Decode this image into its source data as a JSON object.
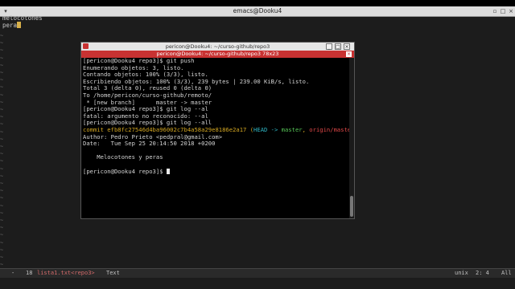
{
  "emacs": {
    "title": "emacs@Dooku4",
    "buffer_lines": [
      "melocotones",
      "pera"
    ],
    "modeline": {
      "status": "-",
      "line": "18",
      "buffer": "lista1.txt<repo3>",
      "mode": "Text",
      "encoding": "unix",
      "position": "2: 4",
      "scroll": "All"
    }
  },
  "terminal": {
    "window_title": "pericon@Dooku4: ~/curso-github/repo3",
    "tab_title": "pericon@Dooku4: ~/curso-github/repo3 78x23",
    "lines": [
      "[pericon@Dooku4 repo3]$ git push",
      "Enumerando objetos: 3, listo.",
      "Contando objetos: 100% (3/3), listo.",
      "Escribiendo objetos: 100% (3/3), 239 bytes | 239.00 KiB/s, listo.",
      "Total 3 (delta 0), reused 0 (delta 0)",
      "To /home/pericon/curso-github/remoto/",
      " * [new branch]      master -> master",
      "[pericon@Dooku4 repo3]$ git log --al",
      "fatal: argumento no reconocido: --al",
      "[pericon@Dooku4 repo3]$ git log --all"
    ],
    "commit": {
      "label": "commit",
      "hash": "efb8fc27546d4ba96002c7b4a58a29e8186e2a17",
      "open": " (",
      "head": "HEAD -> ",
      "branch": "master",
      "sep": ", ",
      "origin": "origin/master",
      "close": ")"
    },
    "author": "Author: Pedro Prieto <pedpral@gmail.com>",
    "date": "Date:   Tue Sep 25 20:14:50 2018 +0200",
    "message": "    Melocotones y peras",
    "prompt": "[pericon@Dooku4 repo3]$ "
  },
  "colors": {
    "accent_red": "#c83232",
    "hash_yellow": "#d4a722",
    "head_cyan": "#2fb6c4",
    "branch_green": "#56c456"
  }
}
